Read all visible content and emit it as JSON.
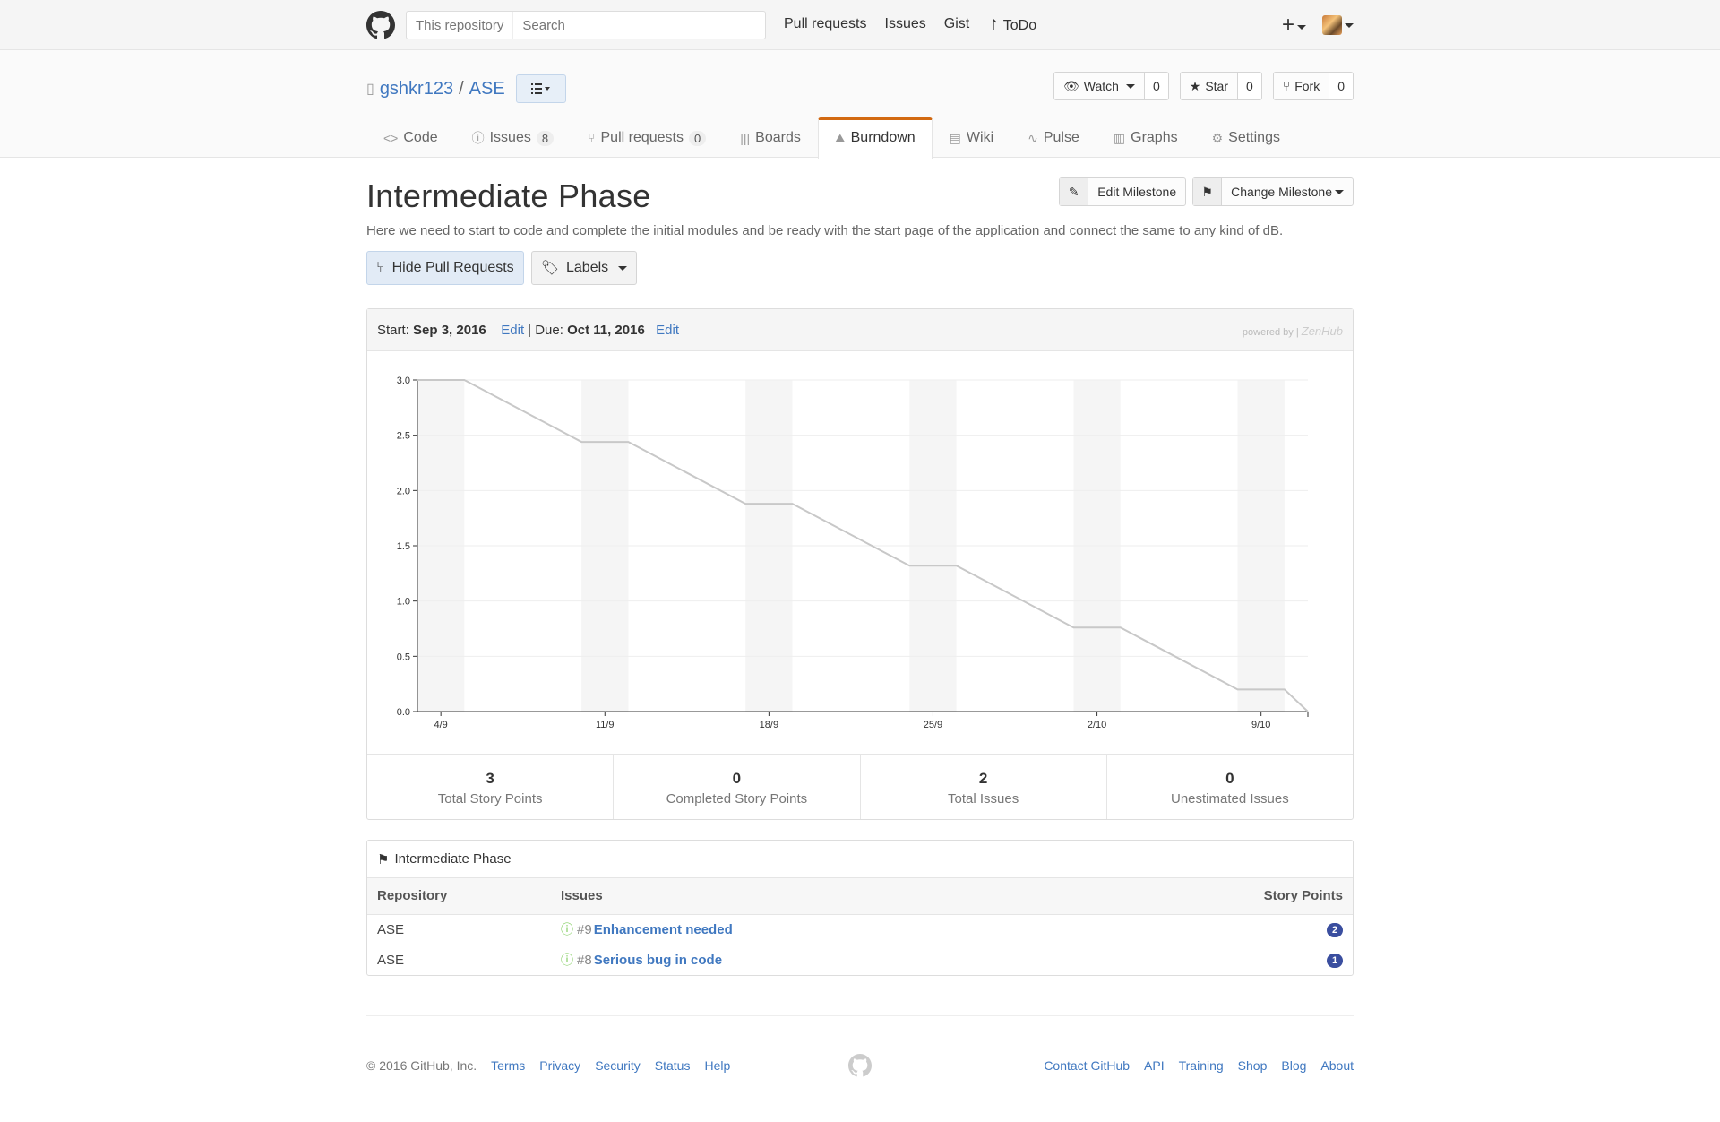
{
  "header": {
    "search_scope": "This repository",
    "search_placeholder": "Search",
    "nav": [
      "Pull requests",
      "Issues",
      "Gist",
      "ToDo"
    ]
  },
  "repo": {
    "owner": "gshkr123",
    "name": "ASE",
    "watch_label": "Watch",
    "watch_count": "0",
    "star_label": "Star",
    "star_count": "0",
    "fork_label": "Fork",
    "fork_count": "0"
  },
  "tabs": [
    {
      "label": "Code",
      "icon": "code-icon"
    },
    {
      "label": "Issues",
      "count": "8",
      "icon": "issue-icon"
    },
    {
      "label": "Pull requests",
      "count": "0",
      "icon": "pull-request-icon"
    },
    {
      "label": "Boards",
      "icon": "boards-icon"
    },
    {
      "label": "Burndown",
      "icon": "burndown-icon",
      "selected": true
    },
    {
      "label": "Wiki",
      "icon": "wiki-icon"
    },
    {
      "label": "Pulse",
      "icon": "pulse-icon"
    },
    {
      "label": "Graphs",
      "icon": "graph-icon"
    },
    {
      "label": "Settings",
      "icon": "gear-icon"
    }
  ],
  "milestone": {
    "title": "Intermediate Phase",
    "description": "Here we need to start to code and complete the initial modules and be ready with the start page of the application and connect the same to any kind of dB.",
    "edit_label": "Edit Milestone",
    "change_label": "Change Milestone",
    "hide_pr_label": "Hide Pull Requests",
    "labels_label": "Labels"
  },
  "burndown": {
    "start_label": "Start:",
    "start_date": "Sep 3, 2016",
    "edit1": "Edit",
    "due_label": "| Due:",
    "due_date": "Oct 11, 2016",
    "edit2": "Edit",
    "powered_by": "powered by |",
    "powered_brand": "ZenHub"
  },
  "chart_data": {
    "type": "line",
    "x_tick_labels": [
      "4/9",
      "11/9",
      "18/9",
      "25/9",
      "2/10",
      "9/10"
    ],
    "y_tick_labels": [
      "0.0",
      "0.5",
      "1.0",
      "1.5",
      "2.0",
      "2.5",
      "3.0"
    ],
    "ylim": [
      0,
      3
    ],
    "x_range_days": [
      0,
      38
    ],
    "weekend_bands_days": [
      [
        0,
        2
      ],
      [
        7,
        9
      ],
      [
        14,
        16
      ],
      [
        21,
        23
      ],
      [
        28,
        30
      ],
      [
        35,
        37
      ]
    ],
    "series": [
      {
        "x_days": [
          0,
          2,
          7,
          9,
          14,
          16,
          21,
          23,
          28,
          30,
          35,
          37,
          38
        ],
        "values": [
          3.0,
          3.0,
          2.44,
          2.44,
          1.88,
          1.88,
          1.32,
          1.32,
          0.76,
          0.76,
          0.2,
          0.2,
          0.0
        ]
      }
    ],
    "colors": {
      "line": "#c8c8c8",
      "band": "#f5f5f5",
      "grid": "#eeeeee",
      "axis": "#333333"
    }
  },
  "stats": [
    {
      "value": "3",
      "label": "Total Story Points"
    },
    {
      "value": "0",
      "label": "Completed Story Points"
    },
    {
      "value": "2",
      "label": "Total Issues"
    },
    {
      "value": "0",
      "label": "Unestimated Issues"
    }
  ],
  "issues_panel": {
    "title": "Intermediate Phase",
    "headers": {
      "repo": "Repository",
      "issues": "Issues",
      "points": "Story Points"
    },
    "rows": [
      {
        "repo": "ASE",
        "num": "#9",
        "title": "Enhancement needed",
        "points": "2"
      },
      {
        "repo": "ASE",
        "num": "#8",
        "title": "Serious bug in code",
        "points": "1"
      }
    ]
  },
  "footer": {
    "copyright": "© 2016 GitHub, Inc.",
    "left_links": [
      "Terms",
      "Privacy",
      "Security",
      "Status",
      "Help"
    ],
    "right_links": [
      "Contact GitHub",
      "API",
      "Training",
      "Shop",
      "Blog",
      "About"
    ]
  }
}
